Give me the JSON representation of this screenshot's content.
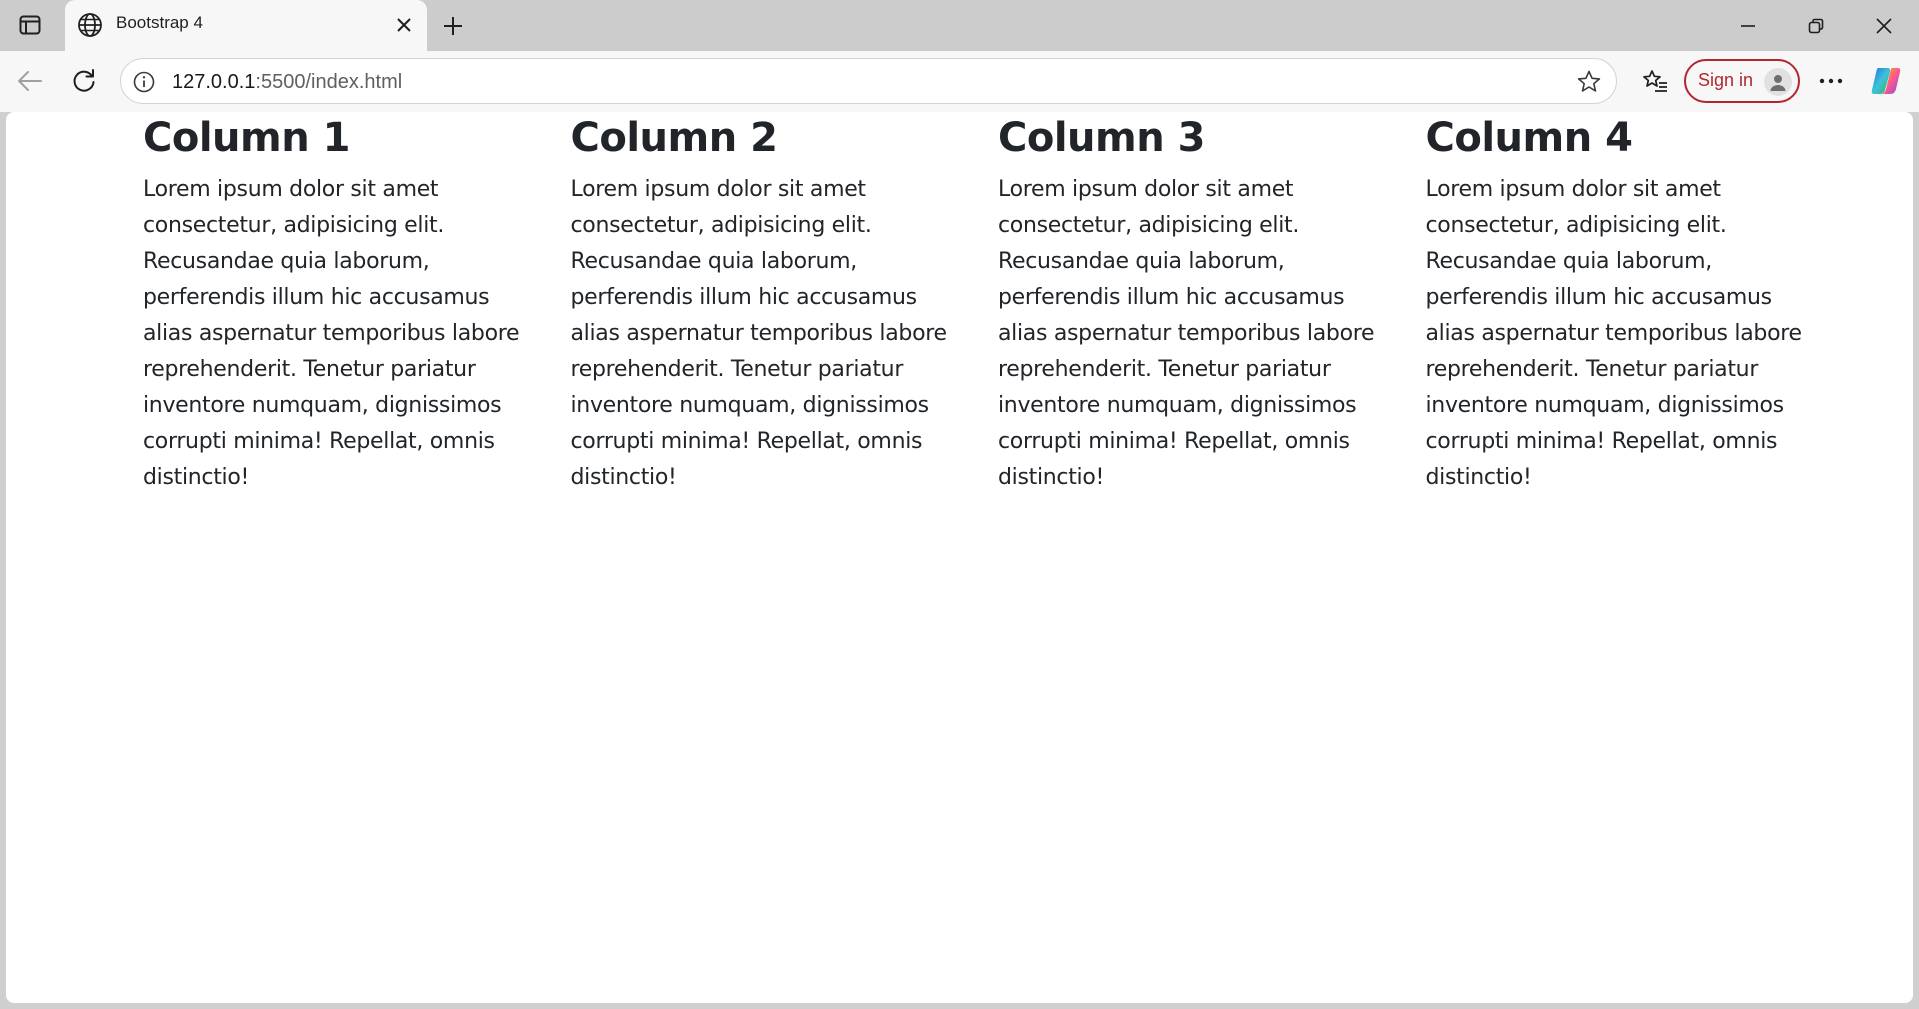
{
  "browser": {
    "tab": {
      "title": "Bootstrap 4",
      "favicon": "globe-icon"
    },
    "address_bar": {
      "host": "127.0.0.1",
      "rest": ":5500/index.html"
    },
    "sign_in_label": "Sign in",
    "icons": {
      "tab_actions": "tab-actions-icon",
      "close_tab": "close-icon",
      "new_tab": "plus-icon",
      "minimize": "minimize-icon",
      "restore": "restore-icon",
      "close_window": "close-icon",
      "back": "back-arrow-icon",
      "reload": "reload-icon",
      "site_info": "info-icon",
      "favorite": "star-icon",
      "favorites": "favorites-icon",
      "more": "more-icon",
      "copilot": "copilot-icon"
    },
    "colors": {
      "sign_in_accent": "#b3262e",
      "text": "#212529"
    }
  },
  "page": {
    "columns": [
      {
        "heading": "Column 1",
        "text": "Lorem ipsum dolor sit amet consectetur, adipisicing elit. Recusandae quia laborum, perferendis illum hic accusamus alias aspernatur temporibus labore reprehenderit. Tenetur pariatur inventore numquam, dignissimos corrupti minima! Repellat, omnis distinctio!"
      },
      {
        "heading": "Column 2",
        "text": "Lorem ipsum dolor sit amet consectetur, adipisicing elit. Recusandae quia laborum, perferendis illum hic accusamus alias aspernatur temporibus labore reprehenderit. Tenetur pariatur inventore numquam, dignissimos corrupti minima! Repellat, omnis distinctio!"
      },
      {
        "heading": "Column 3",
        "text": "Lorem ipsum dolor sit amet consectetur, adipisicing elit. Recusandae quia laborum, perferendis illum hic accusamus alias aspernatur temporibus labore reprehenderit. Tenetur pariatur inventore numquam, dignissimos corrupti minima! Repellat, omnis distinctio!"
      },
      {
        "heading": "Column 4",
        "text": "Lorem ipsum dolor sit amet consectetur, adipisicing elit. Recusandae quia laborum, perferendis illum hic accusamus alias aspernatur temporibus labore reprehenderit. Tenetur pariatur inventore numquam, dignissimos corrupti minima! Repellat, omnis distinctio!"
      }
    ]
  }
}
